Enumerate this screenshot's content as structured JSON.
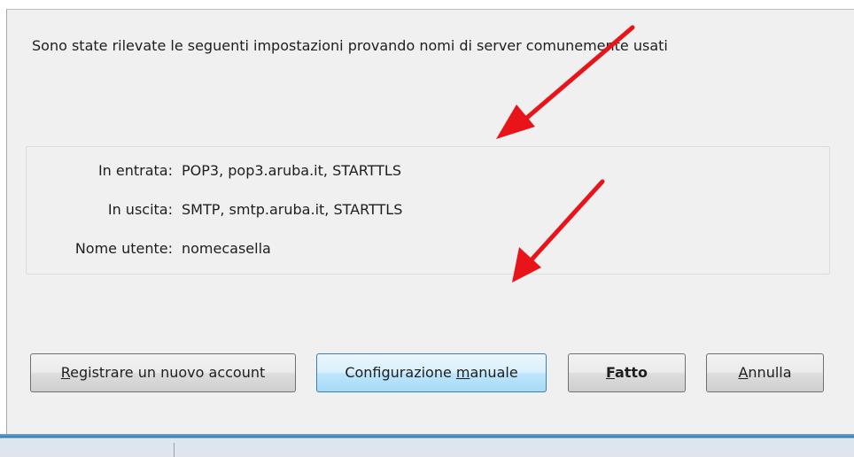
{
  "dialog": {
    "message": "Sono state rilevate le seguenti impostazioni provando nomi di server comunemente usati"
  },
  "settings": {
    "incoming": {
      "label": "In entrata:",
      "value": "POP3, pop3.aruba.it, STARTTLS"
    },
    "outgoing": {
      "label": "In uscita:",
      "value": "SMTP, smtp.aruba.it, STARTTLS"
    },
    "username": {
      "label": "Nome utente:",
      "value": "nomecasella"
    }
  },
  "buttons": {
    "register": {
      "mnemonic": "R",
      "rest": "egistrare un nuovo account"
    },
    "manual": {
      "before": "Configurazione ",
      "mnemonic": "m",
      "after": "anuale"
    },
    "done": {
      "mnemonic": "F",
      "rest": "atto"
    },
    "cancel": {
      "mnemonic": "A",
      "rest": "nnulla"
    }
  },
  "colors": {
    "dialog_background": "#f0f0f0",
    "annotation_arrow": "#e8141a",
    "focused_button_border": "#3c7fb1"
  }
}
